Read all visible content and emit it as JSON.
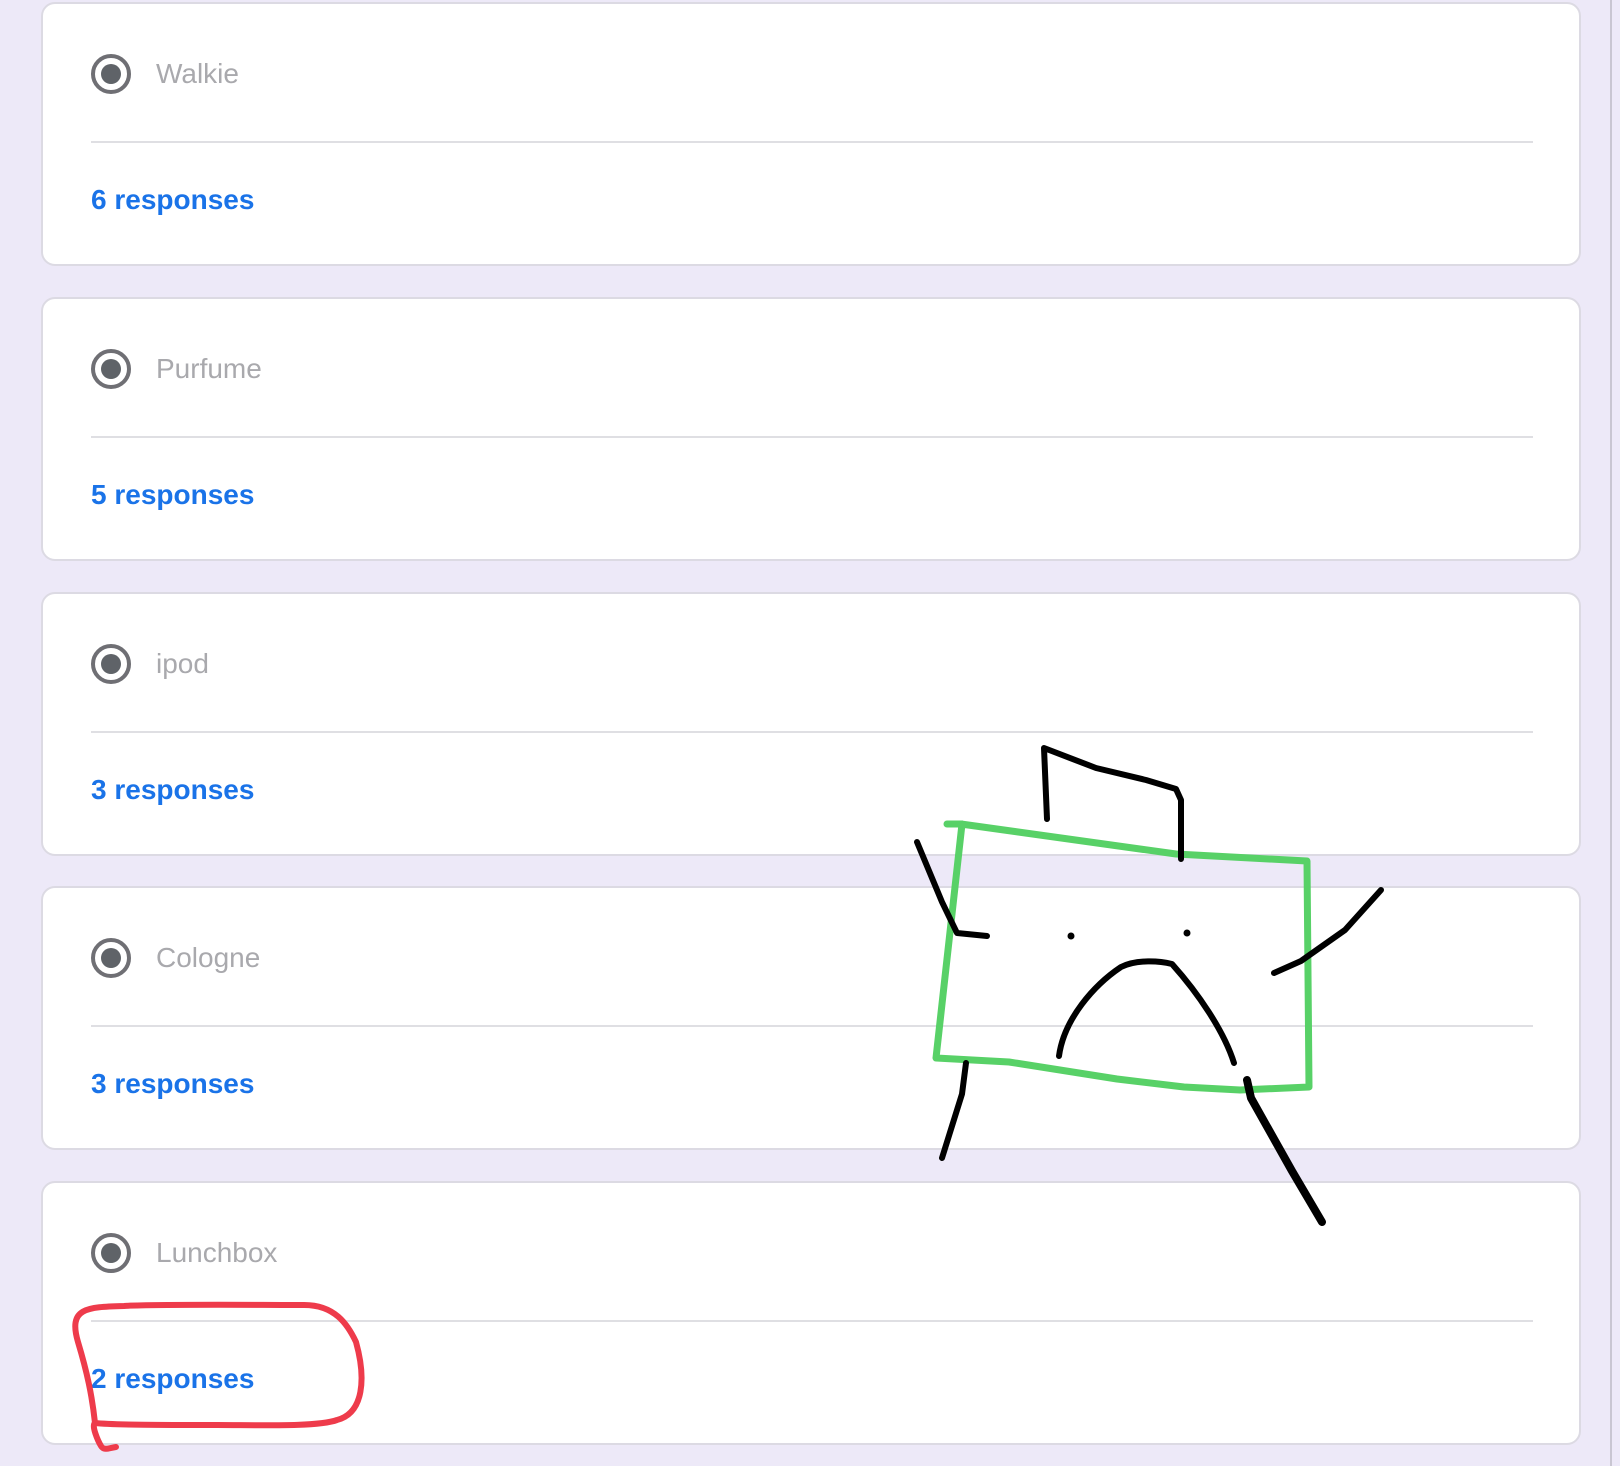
{
  "options": [
    {
      "label": "Walkie",
      "responses": "6 responses"
    },
    {
      "label": "Purfume",
      "responses": "5 responses"
    },
    {
      "label": "ipod",
      "responses": "3 responses"
    },
    {
      "label": "Cologne",
      "responses": "3 responses"
    },
    {
      "label": "Lunchbox",
      "responses": "2 responses"
    }
  ],
  "colors": {
    "page_background": "#ede9f8",
    "card_background": "#ffffff",
    "card_border": "#dcdae3",
    "option_text": "#a9a9ad",
    "radio": "#5f6368",
    "link_blue": "#1a73e8",
    "annotation_red": "#ee3b4b",
    "annotation_green": "#58d167",
    "annotation_black": "#000000"
  },
  "icons": {
    "radio": "selected-radio-icon"
  }
}
